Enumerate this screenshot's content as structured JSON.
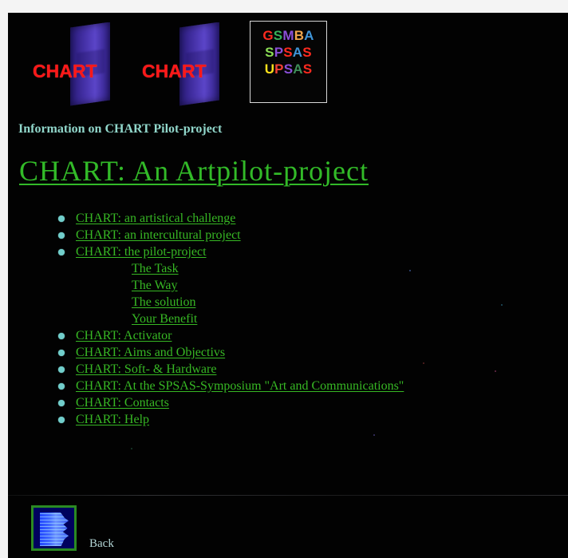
{
  "brand": {
    "logo_word": "CHART",
    "group_logo": [
      {
        "label": "GSMBA",
        "letter_colors": [
          "#ff2a1f",
          "#37b15a",
          "#8a4fd8",
          "#f2a64b",
          "#3f95d8"
        ]
      },
      {
        "label": "SPSAS",
        "letter_colors": [
          "#8bde55",
          "#8a4fd8",
          "#ff2a1f",
          "#3f95d8",
          "#ff2a1f"
        ]
      },
      {
        "label": "UPSAS",
        "letter_colors": [
          "#ffe11b",
          "#f24135",
          "#8a4fd8",
          "#3e8d59",
          "#ff2a1f"
        ]
      }
    ]
  },
  "header": {
    "intro": "Information on CHART Pilot-project",
    "title": "CHART: An Artpilot-project"
  },
  "navigation": {
    "items": [
      {
        "label": "CHART: an artistical challenge"
      },
      {
        "label": "CHART: an intercultural project"
      },
      {
        "label": "CHART: the pilot-project",
        "subitems": [
          {
            "label": "The Task"
          },
          {
            "label": "The Way "
          },
          {
            "label": "The solution"
          },
          {
            "label": "Your Benefit"
          }
        ]
      },
      {
        "label": "CHART: Activator "
      },
      {
        "label": "CHART: Aims and Objectivs"
      },
      {
        "label": "CHART: Soft- & Hardware"
      },
      {
        "label": "CHART: At the SPSAS-Symposium \"Art and Communications\""
      },
      {
        "label": "CHART: Contacts"
      },
      {
        "label": "CHART: Help"
      }
    ]
  },
  "footer": {
    "back_label": "Back",
    "back_icon": "back-book-icon"
  },
  "colors": {
    "background": "#020202",
    "page_margin": "#f4f4f4",
    "link_green": "#37b824",
    "bullet_cyan": "#71cecb",
    "intro_cyan": "#91d7cb",
    "logo_red": "#ff1818",
    "logo_blue": "#4531a7"
  }
}
